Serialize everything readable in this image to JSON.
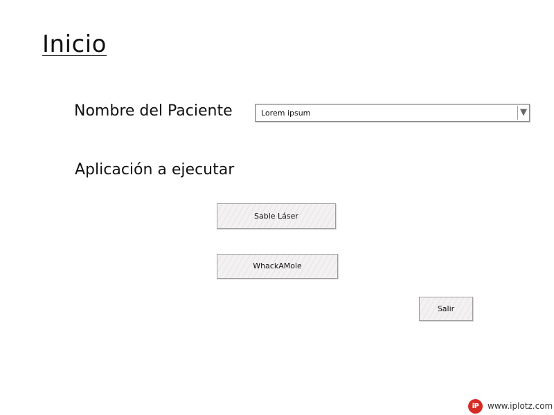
{
  "page": {
    "title": "Inicio"
  },
  "form": {
    "patient_label": "Nombre del Paciente",
    "patient_select_value": "Lorem ipsum",
    "app_label": "Aplicación a ejecutar"
  },
  "buttons": {
    "sable_laser": "Sable Láser",
    "whackamole": "WhackAMole",
    "salir": "Salir"
  },
  "branding": {
    "logo_text": "iP",
    "site": "www.iplotz.com",
    "logo_color": "#d62b25"
  },
  "icons": {
    "select_arrow": "dropdown-arrow-icon"
  }
}
